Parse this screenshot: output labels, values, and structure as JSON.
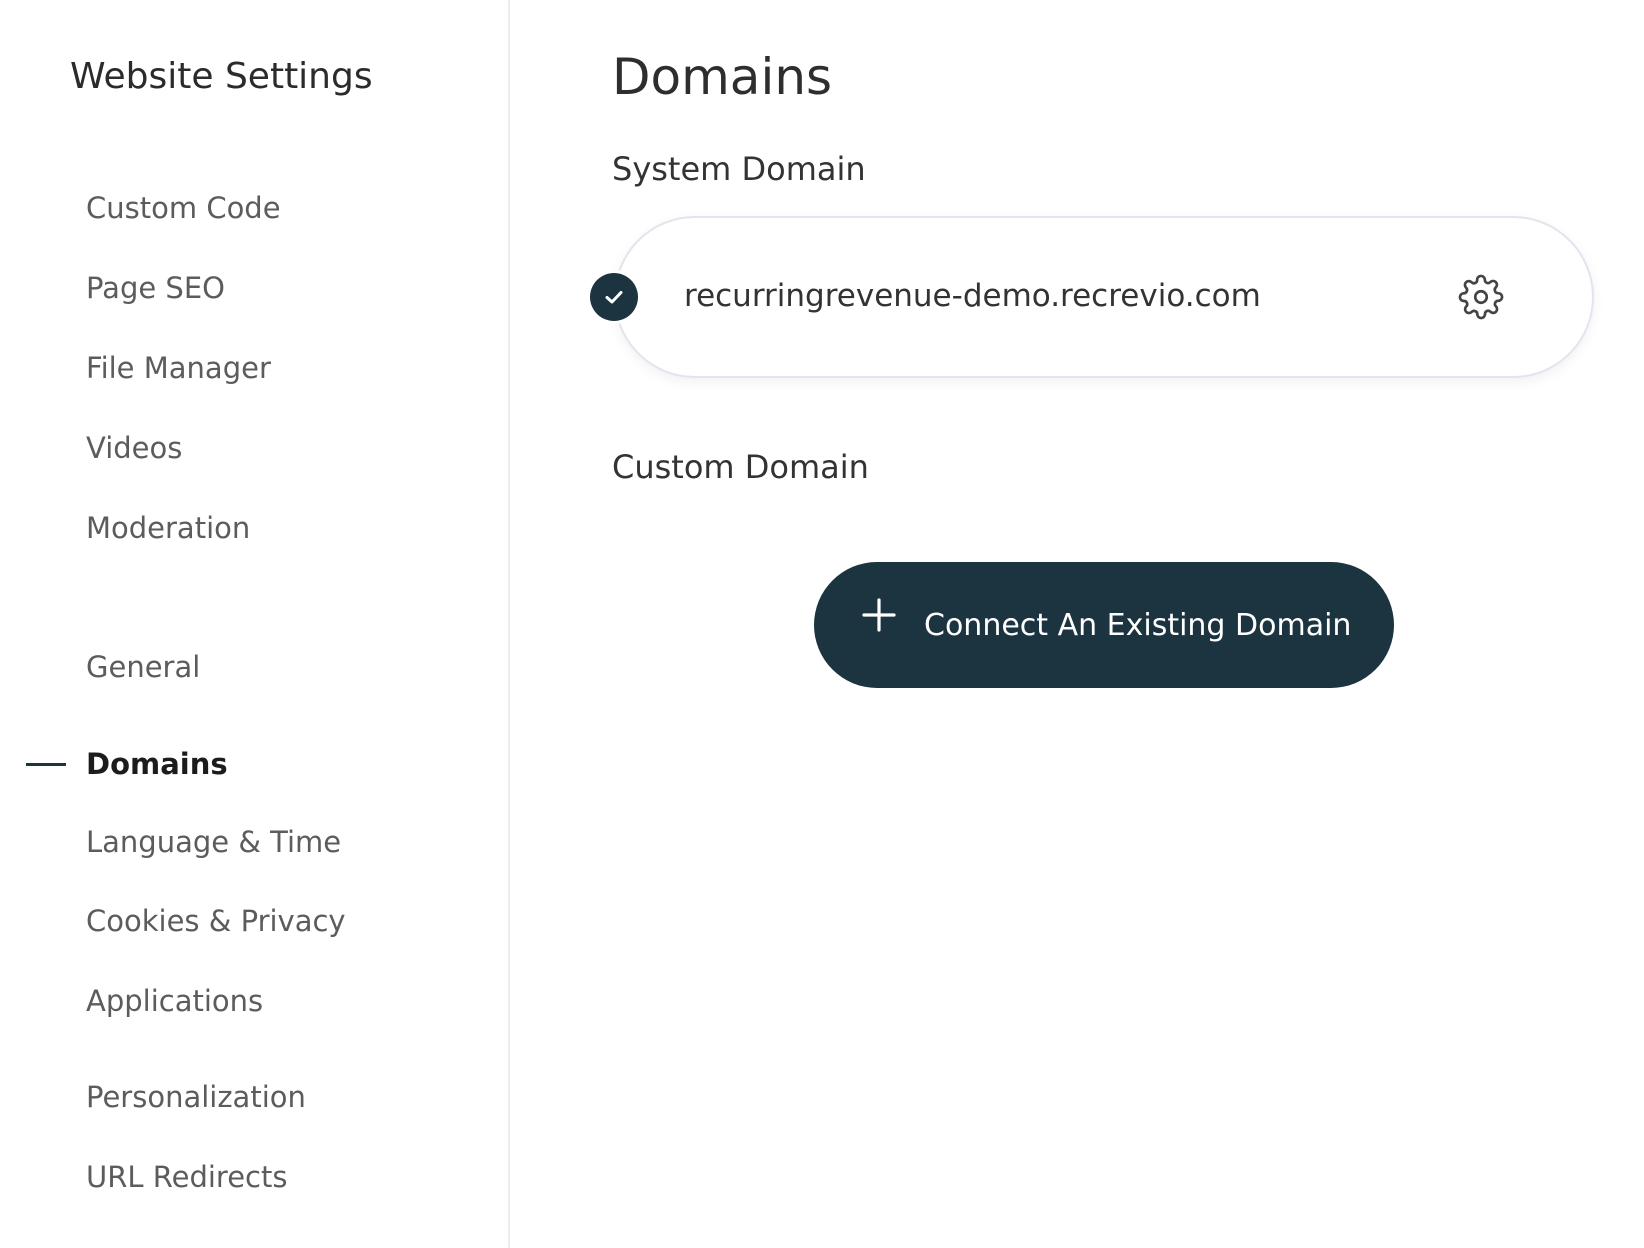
{
  "sidebar": {
    "title": "Website Settings",
    "items": [
      {
        "label": "Custom Code"
      },
      {
        "label": "Page SEO"
      },
      {
        "label": "File Manager"
      },
      {
        "label": "Videos"
      },
      {
        "label": "Moderation"
      },
      {
        "label": "General"
      },
      {
        "label": "Domains",
        "active": true
      },
      {
        "label": "Language & Time"
      },
      {
        "label": "Cookies & Privacy"
      },
      {
        "label": "Applications"
      },
      {
        "label": "Personalization"
      },
      {
        "label": "URL Redirects"
      }
    ]
  },
  "main": {
    "title": "Domains",
    "system_domain": {
      "label": "System Domain",
      "value": "recurringrevenue-demo.recrevio.com",
      "status_icon": "check-icon",
      "settings_icon": "gear-icon"
    },
    "custom_domain": {
      "label": "Custom Domain",
      "button_label": "Connect An Existing Domain",
      "button_icon": "plus-icon"
    }
  },
  "colors": {
    "accent": "#1b3440",
    "text": "#333333",
    "muted": "#5c5c5c",
    "border": "#e4e4ee"
  }
}
